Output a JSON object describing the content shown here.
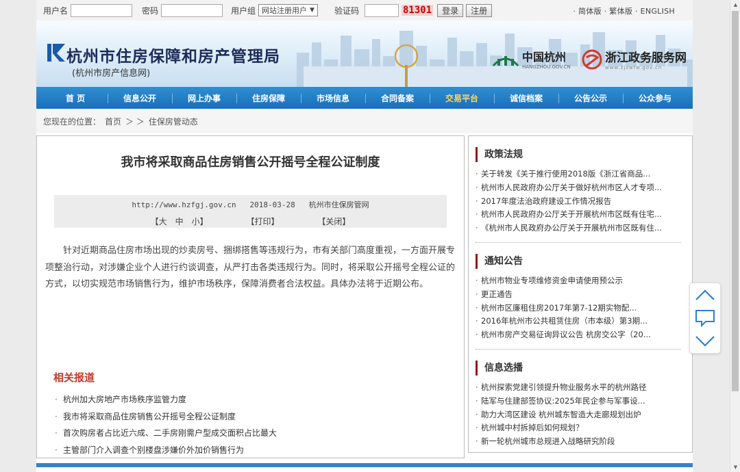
{
  "login": {
    "username_label": "用户名",
    "password_label": "密码",
    "usergroup_label": "用户组",
    "usergroup_value": "网站注册用户",
    "captcha_label": "验证码",
    "captcha_code": "81301",
    "login_btn": "登录",
    "register_btn": "注册",
    "lang": "· 简体版 · 繁体版 · ENGLISH"
  },
  "header": {
    "title": "杭州市住房保障和房产管理局",
    "subtitle": "(杭州市房产信息网)",
    "brand1": "中国杭州",
    "brand1_small": "HANGZHOU.GOV.CN",
    "brand2": "浙江政务服务网",
    "brand2_small": "www.zjzwfw.gov.cn"
  },
  "nav": [
    "首 页",
    "信息公开",
    "网上办事",
    "住房保障",
    "市场信息",
    "合同备案",
    "交易平台",
    "诚信档案",
    "公告公示",
    "公众参与"
  ],
  "breadcrumb": {
    "prefix": "您现在的位置：",
    "home": "首页",
    "sep": "＞ ＞",
    "current": "住保房管动态"
  },
  "article": {
    "title": "我市将采取商品住房销售公开摇号全程公证制度",
    "url": "http://www.hzfgj.gov.cn",
    "date": "2018-03-28",
    "source": "杭州市住保房管网",
    "font_size": "【大　中　小】",
    "print": "【打印】",
    "close": "【关闭】",
    "body": "针对近期商品住房市场出现的炒卖房号、捆绑搭售等违规行为，市有关部门高度重视，一方面开展专项整治行动，对涉嫌企业个人进行约谈调查，从严打击各类违规行为。同时，将采取公开摇号全程公证的方式，以切实规范市场销售行为，维护市场秩序，保障消费者合法权益。具体办法将于近期公布。"
  },
  "related": {
    "title": "相关报道",
    "items": [
      "杭州加大房地产市场秩序监管力度",
      "我市将采取商品住房销售公开摇号全程公证制度",
      "首次购房者占比近六成、二手房刚需户型成交面积占比最大",
      "主管部门介入调查个别楼盘涉嫌价外加价销售行为"
    ]
  },
  "sidebar": {
    "policy": {
      "title": "政策法规",
      "items": [
        "关于转发《关于推行使用2018版《浙江省商品...",
        "杭州市人民政府办公厅关于做好杭州市区人才专项...",
        "2017年度法治政府建设工作情况报告",
        "杭州市人民政府办公厅关于开展杭州市区既有住宅...",
        "《杭州市人民政府办公厅关于开展杭州市区既有住..."
      ]
    },
    "notice": {
      "title": "通知公告",
      "items": [
        "杭州市物业专项维修资金申请使用预公示",
        "更正通告",
        "杭州市区廉租住房2017年第7-12期实物配...",
        "2016年杭州市公共租赁住房（市本级）第3期...",
        "杭州市房产交易征询异议公告 杭房交公字（20..."
      ]
    },
    "info": {
      "title": "信息选播",
      "items": [
        "杭州探索党建引领提升物业服务水平的杭州路径",
        "陆军与住建部签协议:2025年民企参与军事设...",
        "助力大湾区建设 杭州城东智造大走廊规划出炉",
        "杭州城中村拆掉后如何规划？",
        "新一轮杭州城市总规进入战略研究阶段"
      ]
    }
  },
  "colors": {
    "nav_blue": "#1b6fb8",
    "nav_active": "#ffd76a",
    "related_red": "#c0392b",
    "section_bar": "#8b1a1a"
  }
}
